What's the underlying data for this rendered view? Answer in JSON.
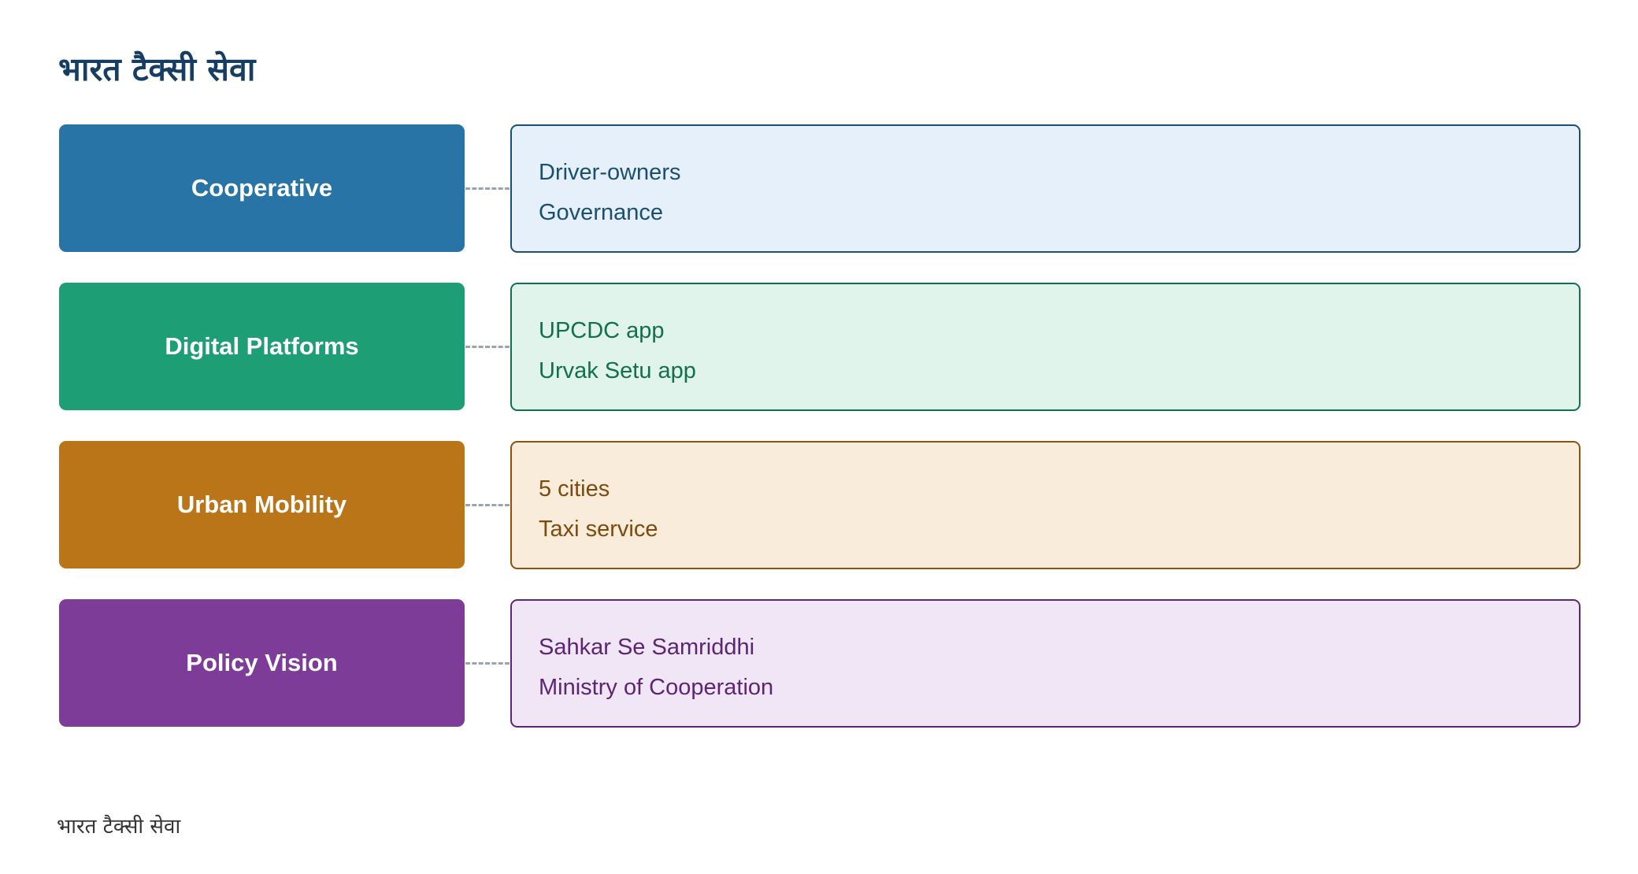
{
  "title": "भारत टैक्सी सेवा",
  "rows": [
    {
      "label": "Cooperative",
      "lines": [
        "Driver-owners",
        "Governance"
      ],
      "colors": {
        "label_bg": "#2874a6",
        "box_bg": "#e5f0fa",
        "box_border": "#1b4f72",
        "text": "#1b4f72"
      }
    },
    {
      "label": "Digital Platforms",
      "lines": [
        "UPCDC app",
        "Urvak Setu app"
      ],
      "colors": {
        "label_bg": "#1e9e74",
        "box_bg": "#e1f4ec",
        "box_border": "#11704f",
        "text": "#11704f"
      }
    },
    {
      "label": "Urban Mobility",
      "lines": [
        "5 cities",
        "Taxi service"
      ],
      "colors": {
        "label_bg": "#b97517",
        "box_bg": "#faecdb",
        "box_border": "#8a5110",
        "text": "#7d4a0e"
      }
    },
    {
      "label": "Policy Vision",
      "lines": [
        "Sahkar Se Samriddhi",
        "Ministry of Cooperation"
      ],
      "colors": {
        "label_bg": "#7d3c98",
        "box_bg": "#f0e6f5",
        "box_border": "#5b2673",
        "text": "#5b2673"
      }
    }
  ],
  "footer": "भारत टैक्सी सेवा"
}
